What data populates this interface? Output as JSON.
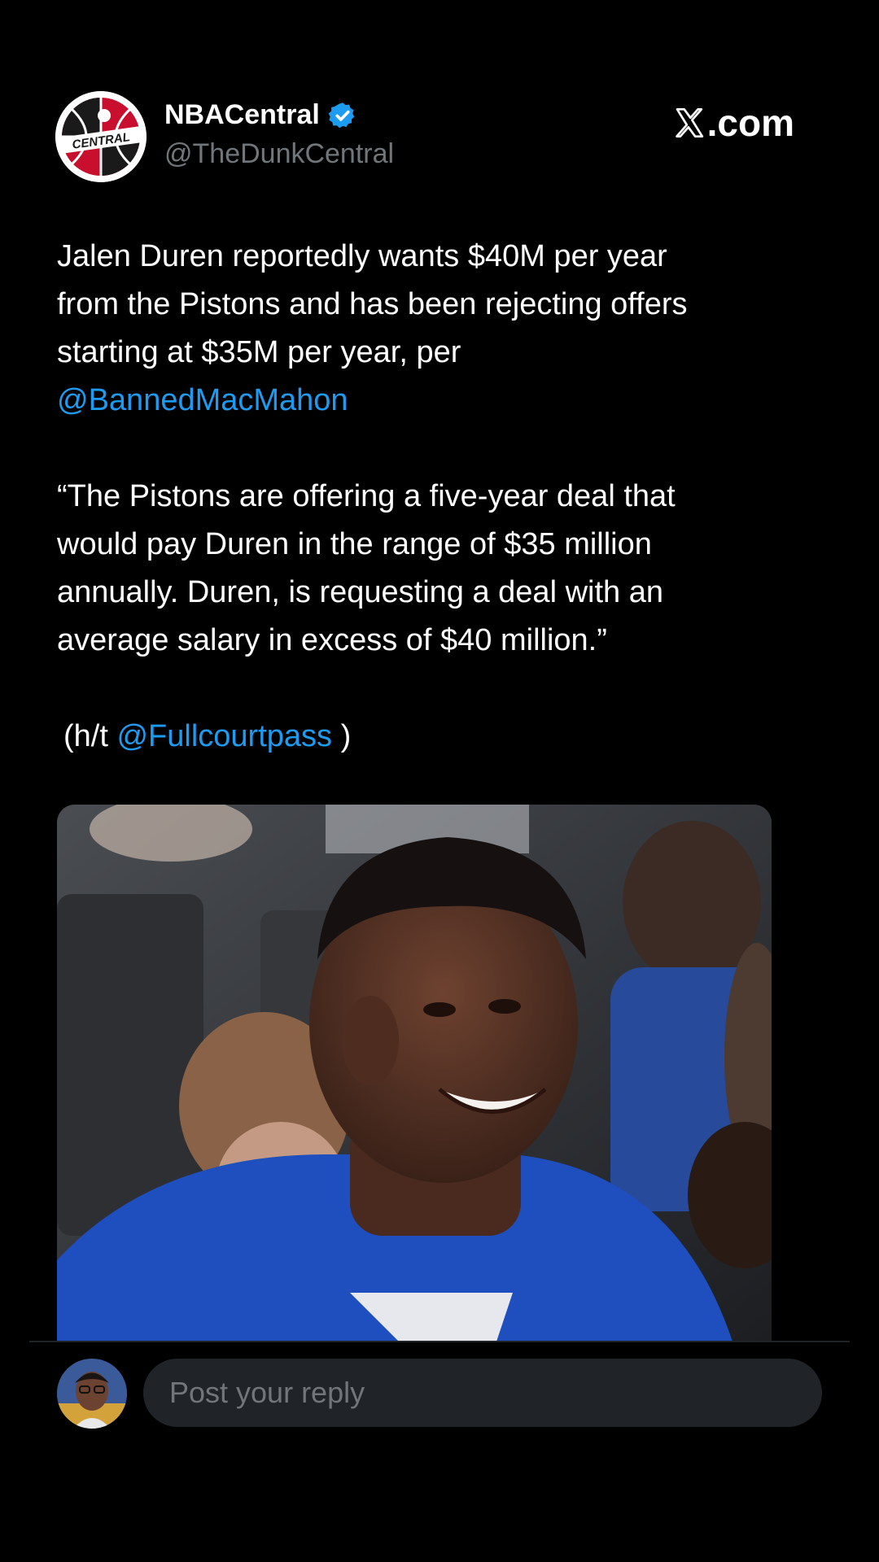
{
  "author": {
    "display_name": "NBACentral",
    "handle": "@TheDunkCentral",
    "avatar_text": "CENTRAL",
    "verified_icon": "verified-badge-icon"
  },
  "brand": {
    "label": ".com",
    "icon": "x-logo-icon"
  },
  "tweet": {
    "line1": "Jalen Duren reportedly wants $40M per year",
    "line2": "from the Pistons and has been rejecting offers",
    "line3": "starting at $35M per year, per",
    "mention1": "@BannedMacMahon",
    "quote_line1": "“The Pistons are offering a five-year deal that",
    "quote_line2": "would pay Duren in the range of $35 million",
    "quote_line3": "annually. Duren, is requesting a deal with an",
    "quote_line4": "average salary in excess of $40 million.”",
    "ht_prefix": "(h/t",
    "ht_mention": "@Fullcourtpass",
    "ht_suffix": ")"
  },
  "reply": {
    "placeholder": "Post your reply"
  },
  "colors": {
    "background": "#000000",
    "text": "#ffffff",
    "muted": "#71767b",
    "link": "#1d9bf0",
    "verified": "#1d9bf0",
    "jersey_blue": "#1f4fbf"
  }
}
